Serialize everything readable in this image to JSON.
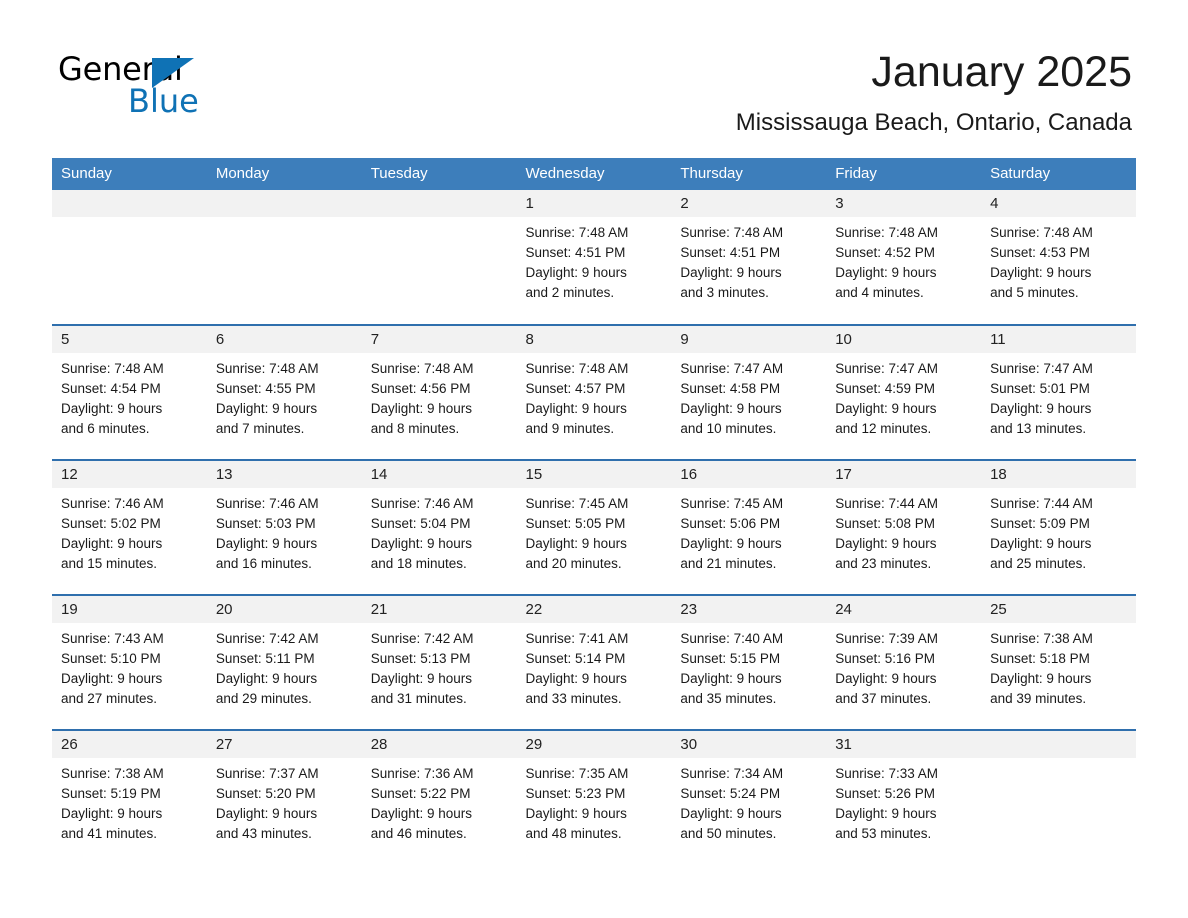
{
  "logo": {
    "word_one": "General",
    "word_two": "Blue",
    "triangle_color": "#0f72b5",
    "blue_color": "#0f72b5"
  },
  "header": {
    "month_title": "January 2025",
    "location": "Mississauga Beach, Ontario, Canada"
  },
  "colors": {
    "header_row_bg": "#3d7ebb",
    "week_divider": "#2f6fad",
    "daynum_band_bg": "#f2f2f2",
    "text": "#1a1a1a"
  },
  "weekday_headers": [
    "Sunday",
    "Monday",
    "Tuesday",
    "Wednesday",
    "Thursday",
    "Friday",
    "Saturday"
  ],
  "weeks": [
    [
      {
        "day": "",
        "sunrise": "",
        "sunset": "",
        "daylight_line1": "",
        "daylight_line2": "",
        "empty": true
      },
      {
        "day": "",
        "sunrise": "",
        "sunset": "",
        "daylight_line1": "",
        "daylight_line2": "",
        "empty": true
      },
      {
        "day": "",
        "sunrise": "",
        "sunset": "",
        "daylight_line1": "",
        "daylight_line2": "",
        "empty": true
      },
      {
        "day": "1",
        "sunrise": "Sunrise: 7:48 AM",
        "sunset": "Sunset: 4:51 PM",
        "daylight_line1": "Daylight: 9 hours",
        "daylight_line2": "and 2 minutes.",
        "empty": false
      },
      {
        "day": "2",
        "sunrise": "Sunrise: 7:48 AM",
        "sunset": "Sunset: 4:51 PM",
        "daylight_line1": "Daylight: 9 hours",
        "daylight_line2": "and 3 minutes.",
        "empty": false
      },
      {
        "day": "3",
        "sunrise": "Sunrise: 7:48 AM",
        "sunset": "Sunset: 4:52 PM",
        "daylight_line1": "Daylight: 9 hours",
        "daylight_line2": "and 4 minutes.",
        "empty": false
      },
      {
        "day": "4",
        "sunrise": "Sunrise: 7:48 AM",
        "sunset": "Sunset: 4:53 PM",
        "daylight_line1": "Daylight: 9 hours",
        "daylight_line2": "and 5 minutes.",
        "empty": false
      }
    ],
    [
      {
        "day": "5",
        "sunrise": "Sunrise: 7:48 AM",
        "sunset": "Sunset: 4:54 PM",
        "daylight_line1": "Daylight: 9 hours",
        "daylight_line2": "and 6 minutes.",
        "empty": false
      },
      {
        "day": "6",
        "sunrise": "Sunrise: 7:48 AM",
        "sunset": "Sunset: 4:55 PM",
        "daylight_line1": "Daylight: 9 hours",
        "daylight_line2": "and 7 minutes.",
        "empty": false
      },
      {
        "day": "7",
        "sunrise": "Sunrise: 7:48 AM",
        "sunset": "Sunset: 4:56 PM",
        "daylight_line1": "Daylight: 9 hours",
        "daylight_line2": "and 8 minutes.",
        "empty": false
      },
      {
        "day": "8",
        "sunrise": "Sunrise: 7:48 AM",
        "sunset": "Sunset: 4:57 PM",
        "daylight_line1": "Daylight: 9 hours",
        "daylight_line2": "and 9 minutes.",
        "empty": false
      },
      {
        "day": "9",
        "sunrise": "Sunrise: 7:47 AM",
        "sunset": "Sunset: 4:58 PM",
        "daylight_line1": "Daylight: 9 hours",
        "daylight_line2": "and 10 minutes.",
        "empty": false
      },
      {
        "day": "10",
        "sunrise": "Sunrise: 7:47 AM",
        "sunset": "Sunset: 4:59 PM",
        "daylight_line1": "Daylight: 9 hours",
        "daylight_line2": "and 12 minutes.",
        "empty": false
      },
      {
        "day": "11",
        "sunrise": "Sunrise: 7:47 AM",
        "sunset": "Sunset: 5:01 PM",
        "daylight_line1": "Daylight: 9 hours",
        "daylight_line2": "and 13 minutes.",
        "empty": false
      }
    ],
    [
      {
        "day": "12",
        "sunrise": "Sunrise: 7:46 AM",
        "sunset": "Sunset: 5:02 PM",
        "daylight_line1": "Daylight: 9 hours",
        "daylight_line2": "and 15 minutes.",
        "empty": false
      },
      {
        "day": "13",
        "sunrise": "Sunrise: 7:46 AM",
        "sunset": "Sunset: 5:03 PM",
        "daylight_line1": "Daylight: 9 hours",
        "daylight_line2": "and 16 minutes.",
        "empty": false
      },
      {
        "day": "14",
        "sunrise": "Sunrise: 7:46 AM",
        "sunset": "Sunset: 5:04 PM",
        "daylight_line1": "Daylight: 9 hours",
        "daylight_line2": "and 18 minutes.",
        "empty": false
      },
      {
        "day": "15",
        "sunrise": "Sunrise: 7:45 AM",
        "sunset": "Sunset: 5:05 PM",
        "daylight_line1": "Daylight: 9 hours",
        "daylight_line2": "and 20 minutes.",
        "empty": false
      },
      {
        "day": "16",
        "sunrise": "Sunrise: 7:45 AM",
        "sunset": "Sunset: 5:06 PM",
        "daylight_line1": "Daylight: 9 hours",
        "daylight_line2": "and 21 minutes.",
        "empty": false
      },
      {
        "day": "17",
        "sunrise": "Sunrise: 7:44 AM",
        "sunset": "Sunset: 5:08 PM",
        "daylight_line1": "Daylight: 9 hours",
        "daylight_line2": "and 23 minutes.",
        "empty": false
      },
      {
        "day": "18",
        "sunrise": "Sunrise: 7:44 AM",
        "sunset": "Sunset: 5:09 PM",
        "daylight_line1": "Daylight: 9 hours",
        "daylight_line2": "and 25 minutes.",
        "empty": false
      }
    ],
    [
      {
        "day": "19",
        "sunrise": "Sunrise: 7:43 AM",
        "sunset": "Sunset: 5:10 PM",
        "daylight_line1": "Daylight: 9 hours",
        "daylight_line2": "and 27 minutes.",
        "empty": false
      },
      {
        "day": "20",
        "sunrise": "Sunrise: 7:42 AM",
        "sunset": "Sunset: 5:11 PM",
        "daylight_line1": "Daylight: 9 hours",
        "daylight_line2": "and 29 minutes.",
        "empty": false
      },
      {
        "day": "21",
        "sunrise": "Sunrise: 7:42 AM",
        "sunset": "Sunset: 5:13 PM",
        "daylight_line1": "Daylight: 9 hours",
        "daylight_line2": "and 31 minutes.",
        "empty": false
      },
      {
        "day": "22",
        "sunrise": "Sunrise: 7:41 AM",
        "sunset": "Sunset: 5:14 PM",
        "daylight_line1": "Daylight: 9 hours",
        "daylight_line2": "and 33 minutes.",
        "empty": false
      },
      {
        "day": "23",
        "sunrise": "Sunrise: 7:40 AM",
        "sunset": "Sunset: 5:15 PM",
        "daylight_line1": "Daylight: 9 hours",
        "daylight_line2": "and 35 minutes.",
        "empty": false
      },
      {
        "day": "24",
        "sunrise": "Sunrise: 7:39 AM",
        "sunset": "Sunset: 5:16 PM",
        "daylight_line1": "Daylight: 9 hours",
        "daylight_line2": "and 37 minutes.",
        "empty": false
      },
      {
        "day": "25",
        "sunrise": "Sunrise: 7:38 AM",
        "sunset": "Sunset: 5:18 PM",
        "daylight_line1": "Daylight: 9 hours",
        "daylight_line2": "and 39 minutes.",
        "empty": false
      }
    ],
    [
      {
        "day": "26",
        "sunrise": "Sunrise: 7:38 AM",
        "sunset": "Sunset: 5:19 PM",
        "daylight_line1": "Daylight: 9 hours",
        "daylight_line2": "and 41 minutes.",
        "empty": false
      },
      {
        "day": "27",
        "sunrise": "Sunrise: 7:37 AM",
        "sunset": "Sunset: 5:20 PM",
        "daylight_line1": "Daylight: 9 hours",
        "daylight_line2": "and 43 minutes.",
        "empty": false
      },
      {
        "day": "28",
        "sunrise": "Sunrise: 7:36 AM",
        "sunset": "Sunset: 5:22 PM",
        "daylight_line1": "Daylight: 9 hours",
        "daylight_line2": "and 46 minutes.",
        "empty": false
      },
      {
        "day": "29",
        "sunrise": "Sunrise: 7:35 AM",
        "sunset": "Sunset: 5:23 PM",
        "daylight_line1": "Daylight: 9 hours",
        "daylight_line2": "and 48 minutes.",
        "empty": false
      },
      {
        "day": "30",
        "sunrise": "Sunrise: 7:34 AM",
        "sunset": "Sunset: 5:24 PM",
        "daylight_line1": "Daylight: 9 hours",
        "daylight_line2": "and 50 minutes.",
        "empty": false
      },
      {
        "day": "31",
        "sunrise": "Sunrise: 7:33 AM",
        "sunset": "Sunset: 5:26 PM",
        "daylight_line1": "Daylight: 9 hours",
        "daylight_line2": "and 53 minutes.",
        "empty": false
      },
      {
        "day": "",
        "sunrise": "",
        "sunset": "",
        "daylight_line1": "",
        "daylight_line2": "",
        "empty": true
      }
    ]
  ]
}
